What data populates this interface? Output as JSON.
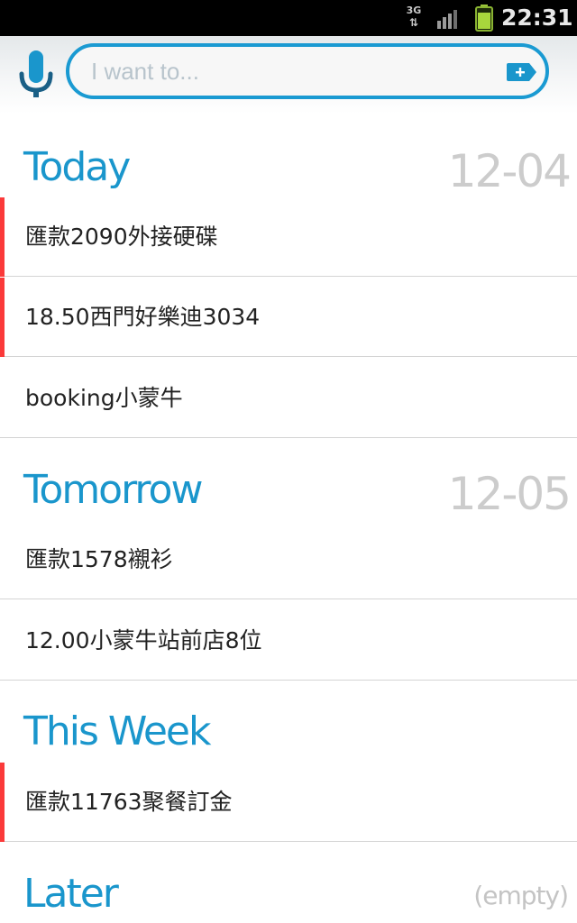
{
  "status_bar": {
    "network": "3G",
    "time": "22:31"
  },
  "search": {
    "placeholder": "I want to...",
    "value": ""
  },
  "sections": [
    {
      "title": "Today",
      "date": "12-04",
      "tasks": [
        {
          "text": "匯款2090外接硬碟",
          "priority": true
        },
        {
          "text": "18.50西門好樂迪3034",
          "priority": true
        },
        {
          "text": "booking小蒙牛",
          "priority": false
        }
      ]
    },
    {
      "title": "Tomorrow",
      "date": "12-05",
      "tasks": [
        {
          "text": "匯款1578襯衫",
          "priority": false
        },
        {
          "text": "12.00小蒙牛站前店8位",
          "priority": false
        }
      ]
    },
    {
      "title": "This Week",
      "tasks": [
        {
          "text": "匯款11763聚餐訂金",
          "priority": true
        }
      ]
    },
    {
      "title": "Later",
      "empty_label": "(empty)"
    }
  ],
  "colors": {
    "accent": "#1a96cc",
    "priority": "#fb3a3a",
    "date_gray": "#cccccc"
  }
}
